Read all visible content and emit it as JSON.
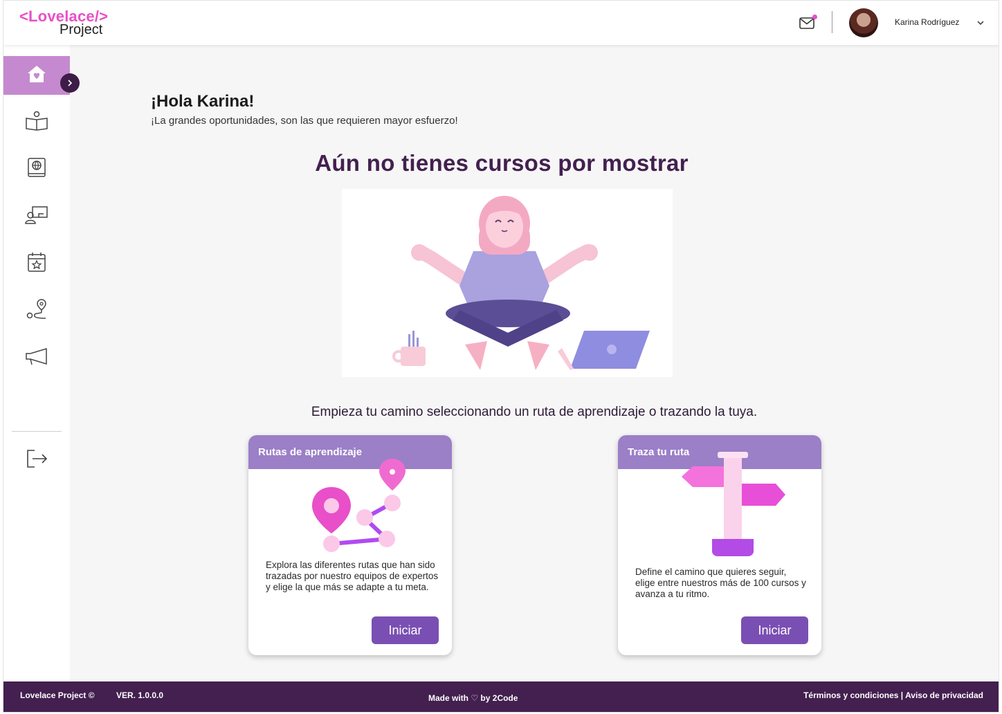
{
  "header": {
    "logo_top": "<Lovelace/>",
    "logo_bottom": "Project",
    "user_name": "Karina Rodríguez",
    "icons": [
      "mail-icon",
      "chevron-down-icon"
    ]
  },
  "sidebar": {
    "items": [
      {
        "name": "home",
        "icon": "home-heart-icon",
        "active": true
      },
      {
        "name": "courses",
        "icon": "open-book-icon"
      },
      {
        "name": "catalog",
        "icon": "globe-book-icon"
      },
      {
        "name": "mentors",
        "icon": "teacher-board-icon"
      },
      {
        "name": "events",
        "icon": "calendar-star-icon"
      },
      {
        "name": "routes",
        "icon": "route-pin-icon"
      },
      {
        "name": "announcements",
        "icon": "megaphone-icon"
      },
      {
        "name": "logout",
        "icon": "logout-icon"
      }
    ]
  },
  "main": {
    "greeting": "¡Hola Karina!",
    "subgreeting": "¡La grandes oportunidades, son las que requieren mayor esfuerzo!",
    "empty_title": "Aún no tienes cursos por mostrar",
    "prompt": "Empieza tu camino seleccionando un ruta de aprendizaje o trazando la tuya.",
    "cards": [
      {
        "title": "Rutas de aprendizaje",
        "text": "Explora las diferentes rutas que han sido trazadas por nuestro equipos de expertos y elige la que más se adapte a tu meta.",
        "button": "Iniciar"
      },
      {
        "title": "Traza tu ruta",
        "text": "Define el camino que quieres seguir, elige entre nuestros más de 100 cursos y avanza a tu ritmo.",
        "button": "Iniciar"
      }
    ]
  },
  "footer": {
    "copyright": "Lovelace Project ©",
    "version": "VER. 1.0.0.0",
    "made_with": "Made with ♡ by 2Code",
    "terms": "Términos y condiciones",
    "separator": " | ",
    "privacy": "Aviso de privacidad"
  },
  "colors": {
    "brand_pink": "#e84fc9",
    "brand_purple": "#43204f",
    "active_sidebar": "#c589cf",
    "card_header": "#9b7fc7",
    "button": "#7a4fb3"
  }
}
